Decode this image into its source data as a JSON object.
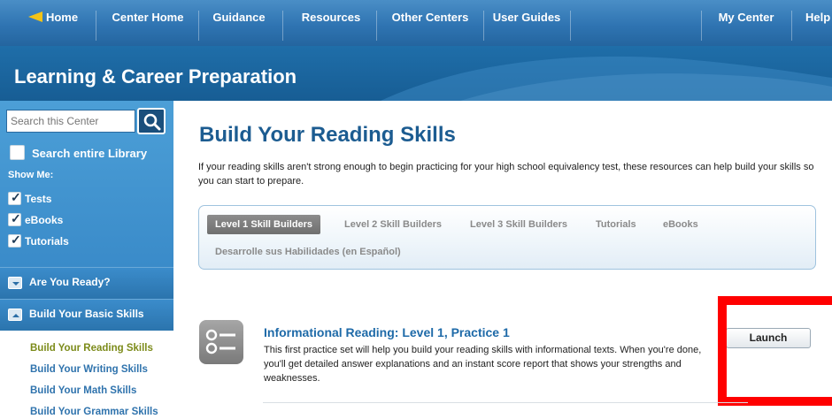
{
  "colors": {
    "nav_blue": "#2f74b2",
    "header_blue": "#1f6ea9",
    "sidebar_blue": "#4c9fd7",
    "title_blue": "#1c5c91",
    "link_blue": "#2f73ad",
    "active_link_olive": "#7c8b1a",
    "highlight_red": "#ff0000"
  },
  "topnav": {
    "home": "Home",
    "center_home": "Center Home",
    "guidance": "Guidance",
    "resources": "Resources",
    "other_centers": "Other Centers",
    "user_guides": "User Guides",
    "my_center": "My Center",
    "help": "Help"
  },
  "header": {
    "title": "Learning & Career Preparation"
  },
  "sidebar": {
    "search_placeholder": "Search this Center",
    "search_entire": "Search entire Library",
    "show_me": "Show Me:",
    "filters": [
      {
        "label": "Tests",
        "checked": true
      },
      {
        "label": "eBooks",
        "checked": true
      },
      {
        "label": "Tutorials",
        "checked": true
      }
    ],
    "sections": [
      {
        "label": "Are You Ready?",
        "icon": "chevron-down-icon"
      },
      {
        "label": "Build Your Basic Skills",
        "icon": "chevron-up-icon"
      }
    ],
    "links": [
      "Build Your Reading Skills",
      "Build Your Writing Skills",
      "Build Your Math Skills",
      "Build Your Grammar Skills"
    ]
  },
  "main": {
    "title": "Build Your Reading Skills",
    "intro": "If your reading skills aren't strong enough to begin practicing for your high school equivalency test, these resources can help build your skills so you can start to prepare.",
    "tabs": [
      "Level 1 Skill Builders",
      "Level 2 Skill Builders",
      "Level 3 Skill Builders",
      "Tutorials",
      "eBooks",
      "Desarrolle sus Habilidades (en Español)"
    ],
    "item": {
      "title": "Informational Reading: Level 1, Practice 1",
      "description": "This first practice set will help you build your reading skills with informational texts. When you're done, you'll get detailed answer explanations and an instant score report that shows your strengths and weaknesses.",
      "launch": "Launch",
      "icon": "test-list-icon"
    }
  }
}
